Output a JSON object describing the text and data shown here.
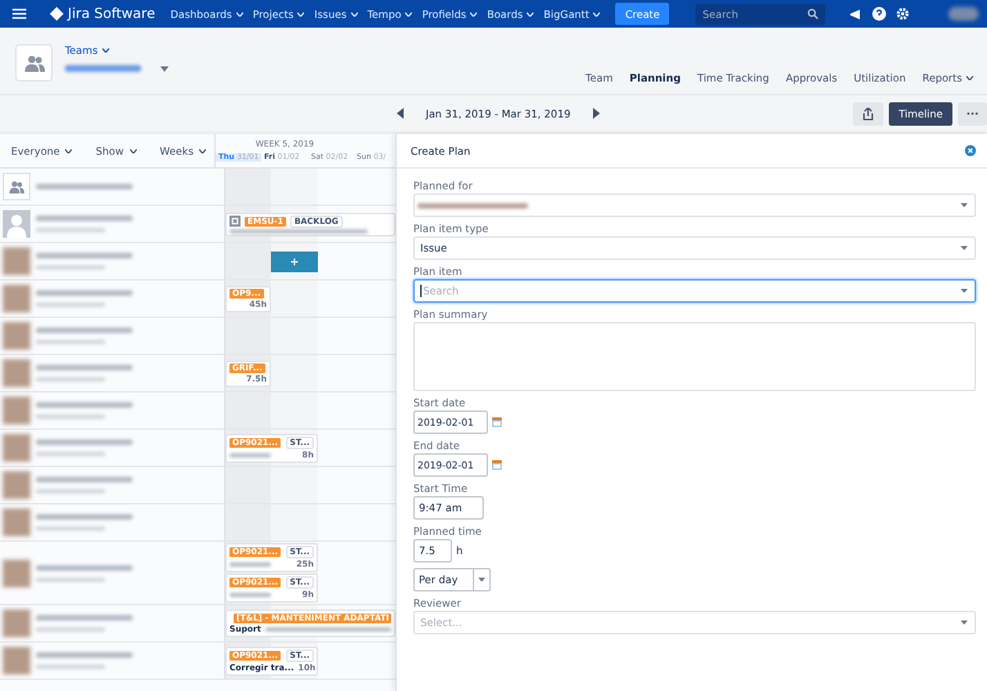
{
  "topnav": {
    "logo": "Jira Software",
    "menu": [
      {
        "label": "Dashboards"
      },
      {
        "label": "Projects"
      },
      {
        "label": "Issues"
      },
      {
        "label": "Tempo"
      },
      {
        "label": "Profields"
      },
      {
        "label": "Boards"
      },
      {
        "label": "BigGantt"
      }
    ],
    "create": "Create",
    "search": {
      "placeholder": "Search"
    }
  },
  "header": {
    "teams": "Teams",
    "tabs": [
      {
        "label": "Team",
        "selected": false,
        "dropdown": false
      },
      {
        "label": "Planning",
        "selected": true,
        "dropdown": false
      },
      {
        "label": "Time Tracking",
        "selected": false,
        "dropdown": false
      },
      {
        "label": "Approvals",
        "selected": false,
        "dropdown": false
      },
      {
        "label": "Utilization",
        "selected": false,
        "dropdown": false
      },
      {
        "label": "Reports",
        "selected": false,
        "dropdown": true
      }
    ]
  },
  "datebar": {
    "range": "Jan 31, 2019 - Mar 31, 2019",
    "timeline": "Timeline",
    "more": "···"
  },
  "grid": {
    "filters": [
      "Everyone",
      "Show",
      "Weeks"
    ],
    "week": "WEEK 5, 2019",
    "days": [
      {
        "name": "Thu",
        "date": "31/01",
        "selected": true,
        "weekend": false
      },
      {
        "name": "Fri",
        "date": "01/02",
        "selected": false,
        "weekend": false
      },
      {
        "name": "Sat",
        "date": "02/02",
        "selected": false,
        "weekend": true
      },
      {
        "name": "Sun",
        "date": "03/",
        "selected": false,
        "weekend": true
      }
    ],
    "rows": [
      {
        "kind": "team",
        "cards": []
      },
      {
        "kind": "generic",
        "cards": [
          {
            "kind": "epic",
            "key": "EMSU-1",
            "status": "BACKLOG"
          }
        ]
      },
      {
        "kind": "photo",
        "cards": [
          {
            "kind": "add",
            "label": "+"
          }
        ]
      },
      {
        "kind": "photo",
        "cards": [
          {
            "kind": "short",
            "key": "OP9...",
            "hours": "45h"
          }
        ]
      },
      {
        "kind": "photo",
        "cards": []
      },
      {
        "kind": "photo",
        "cards": [
          {
            "kind": "short",
            "key": "GRIF...",
            "hours": "7.5h"
          }
        ]
      },
      {
        "kind": "photo",
        "cards": []
      },
      {
        "kind": "photo",
        "cards": [
          {
            "kind": "task",
            "key": "OP9021...",
            "status": "ST...",
            "hours": "8h"
          }
        ]
      },
      {
        "kind": "photo",
        "cards": []
      },
      {
        "kind": "photo",
        "cards": []
      },
      {
        "kind": "photo",
        "cards": [
          {
            "kind": "task",
            "key": "OP9021...",
            "status": "ST...",
            "hours": "25h"
          },
          {
            "kind": "task",
            "key": "OP9021...",
            "status": "ST...",
            "hours": "9h"
          }
        ]
      },
      {
        "kind": "photo",
        "cards": [
          {
            "kind": "epic",
            "key": "[T&L] - MANTENIMENT ADAPTATI",
            "summary": "Suport"
          }
        ]
      },
      {
        "kind": "photo",
        "cards": [
          {
            "kind": "task",
            "key": "OP9021...",
            "status": "ST...",
            "summary": "Corregir tra...",
            "hours": "10h"
          }
        ]
      }
    ]
  },
  "dialog": {
    "title": "Create Plan",
    "fields": [
      {
        "kind": "select",
        "label": "Planned for",
        "blurred": true
      },
      {
        "kind": "select",
        "label": "Plan item type",
        "value": "Issue",
        "blurred": false
      },
      {
        "kind": "select",
        "label": "Plan item",
        "placeholder": "Search",
        "focused": true,
        "blurred": false
      },
      {
        "kind": "textarea",
        "label": "Plan summary"
      },
      {
        "kind": "date",
        "label": "Start date",
        "value": "2019-02-01"
      },
      {
        "kind": "date",
        "label": "End date",
        "value": "2019-02-01"
      },
      {
        "kind": "text",
        "label": "Start Time",
        "value": "9:47 am"
      },
      {
        "kind": "hours",
        "label": "Planned time",
        "value": "7.5",
        "unit": "h"
      },
      {
        "kind": "small-select",
        "value": "Per day"
      },
      {
        "kind": "select",
        "label": "Reviewer",
        "placeholder": "Select...",
        "blurred": false
      }
    ]
  }
}
